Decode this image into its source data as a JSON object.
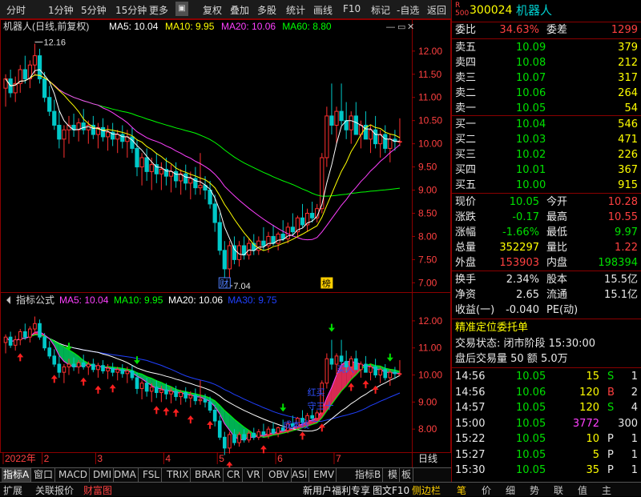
{
  "toolbar": {
    "items": [
      "分时",
      "1分钟",
      "5分钟",
      "15分钟",
      "更多",
      "复权",
      "叠加",
      "多股",
      "统计",
      "画线",
      "F10",
      "标记",
      "-自选",
      "返回"
    ]
  },
  "chart_data": [
    {
      "type": "candlestick",
      "title": "机器人(日线,前复权)",
      "legend": [
        {
          "name": "MA5",
          "value": "10.04",
          "color": "#ffffff"
        },
        {
          "name": "MA10",
          "value": "9.95",
          "color": "#ffff00"
        },
        {
          "name": "MA20",
          "value": "10.06",
          "color": "#ff40ff"
        },
        {
          "name": "MA60",
          "value": "8.80",
          "color": "#00ff00"
        }
      ],
      "y_ticks": [
        "12.00",
        "11.50",
        "11.00",
        "10.50",
        "10.00",
        "9.50",
        "9.00",
        "8.50",
        "8.00",
        "7.50",
        "7.00"
      ],
      "ylim": [
        6.85,
        12.55
      ],
      "annotations": [
        {
          "text": "12.16",
          "price": 12.16
        },
        {
          "text": "7.04",
          "price": 7.04
        }
      ],
      "markers": [
        "财",
        "榜"
      ],
      "ohlc": [
        [
          11.2,
          11.5,
          10.8,
          11.4
        ],
        [
          11.4,
          11.6,
          11.0,
          11.1
        ],
        [
          11.1,
          11.45,
          10.9,
          11.3
        ],
        [
          11.3,
          11.7,
          11.1,
          11.6
        ],
        [
          11.6,
          11.9,
          11.3,
          11.4
        ],
        [
          11.4,
          11.8,
          11.2,
          11.7
        ],
        [
          11.7,
          12.16,
          11.5,
          11.9
        ],
        [
          11.9,
          12.05,
          11.3,
          11.4
        ],
        [
          11.4,
          11.55,
          10.9,
          11.0
        ],
        [
          11.0,
          11.25,
          10.6,
          10.7
        ],
        [
          10.7,
          10.95,
          10.3,
          10.4
        ],
        [
          10.4,
          10.7,
          9.9,
          10.1
        ],
        [
          10.1,
          10.4,
          9.7,
          10.3
        ],
        [
          10.3,
          10.6,
          10.0,
          10.4
        ],
        [
          10.4,
          10.65,
          10.15,
          10.3
        ],
        [
          10.3,
          10.55,
          10.05,
          10.45
        ],
        [
          10.45,
          10.75,
          10.2,
          10.3
        ],
        [
          10.3,
          10.5,
          10.0,
          10.4
        ],
        [
          10.4,
          10.6,
          10.1,
          10.2
        ],
        [
          10.2,
          10.45,
          9.9,
          10.35
        ],
        [
          10.35,
          10.55,
          10.05,
          10.15
        ],
        [
          10.15,
          10.4,
          9.85,
          10.25
        ],
        [
          10.25,
          10.45,
          9.95,
          10.1
        ],
        [
          10.1,
          10.3,
          9.8,
          10.2
        ],
        [
          10.2,
          10.4,
          9.9,
          10.05
        ],
        [
          10.05,
          10.3,
          9.7,
          10.15
        ],
        [
          10.15,
          10.35,
          9.8,
          9.9
        ],
        [
          9.9,
          10.1,
          9.3,
          9.5
        ],
        [
          9.5,
          9.8,
          9.1,
          9.7
        ],
        [
          9.7,
          9.9,
          9.2,
          9.4
        ],
        [
          9.4,
          9.7,
          9.0,
          9.55
        ],
        [
          9.55,
          9.8,
          9.15,
          9.35
        ],
        [
          9.35,
          9.6,
          9.0,
          9.45
        ],
        [
          9.45,
          9.7,
          9.1,
          9.3
        ],
        [
          9.3,
          9.55,
          8.95,
          9.4
        ],
        [
          9.4,
          9.6,
          9.05,
          9.2
        ],
        [
          9.2,
          9.45,
          8.9,
          9.35
        ],
        [
          9.35,
          9.55,
          9.0,
          9.15
        ],
        [
          9.15,
          9.4,
          8.8,
          9.25
        ],
        [
          9.25,
          9.5,
          8.9,
          9.05
        ],
        [
          9.05,
          9.8,
          8.9,
          9.1
        ],
        [
          9.1,
          9.3,
          8.8,
          9.0
        ],
        [
          9.0,
          9.2,
          8.6,
          8.7
        ],
        [
          8.7,
          8.9,
          8.1,
          8.3
        ],
        [
          8.3,
          8.5,
          7.6,
          7.7
        ],
        [
          7.7,
          7.9,
          7.04,
          7.3
        ],
        [
          7.3,
          7.9,
          7.1,
          7.8
        ],
        [
          7.8,
          8.0,
          7.4,
          7.5
        ],
        [
          7.5,
          7.9,
          7.35,
          7.8
        ],
        [
          7.8,
          8.0,
          7.5,
          7.6
        ],
        [
          7.6,
          7.95,
          7.5,
          7.85
        ],
        [
          7.85,
          8.05,
          7.6,
          7.7
        ],
        [
          7.7,
          8.0,
          7.6,
          7.9
        ],
        [
          7.9,
          8.2,
          7.7,
          7.8
        ],
        [
          7.8,
          8.1,
          7.65,
          8.0
        ],
        [
          8.0,
          8.25,
          7.8,
          7.85
        ],
        [
          7.85,
          8.1,
          7.7,
          8.05
        ],
        [
          8.05,
          8.35,
          7.9,
          7.95
        ],
        [
          7.95,
          8.3,
          7.85,
          8.2
        ],
        [
          8.2,
          8.5,
          8.0,
          8.1
        ],
        [
          8.1,
          8.45,
          8.0,
          8.4
        ],
        [
          8.4,
          8.7,
          8.2,
          8.25
        ],
        [
          8.25,
          8.6,
          8.1,
          8.5
        ],
        [
          8.5,
          8.75,
          8.3,
          8.4
        ],
        [
          8.4,
          8.7,
          8.3,
          8.6
        ],
        [
          8.6,
          9.8,
          8.5,
          9.7
        ],
        [
          9.7,
          10.8,
          9.5,
          10.6
        ],
        [
          10.6,
          11.3,
          10.2,
          10.4
        ],
        [
          10.4,
          10.8,
          10.0,
          10.7
        ],
        [
          10.7,
          11.3,
          10.4,
          10.5
        ],
        [
          10.5,
          10.9,
          10.1,
          10.3
        ],
        [
          10.3,
          10.7,
          10.0,
          10.6
        ],
        [
          10.6,
          10.9,
          10.2,
          10.2
        ],
        [
          10.2,
          10.5,
          9.9,
          10.4
        ],
        [
          10.4,
          10.7,
          10.1,
          10.1
        ],
        [
          10.1,
          10.4,
          9.8,
          10.3
        ],
        [
          10.3,
          10.6,
          9.9,
          10.0
        ],
        [
          10.0,
          10.3,
          9.7,
          10.2
        ],
        [
          10.2,
          10.4,
          9.8,
          9.9
        ],
        [
          9.9,
          10.2,
          9.6,
          10.1
        ],
        [
          10.1,
          10.3,
          9.85,
          10.05
        ],
        [
          10.05,
          10.55,
          9.95,
          10.05
        ]
      ]
    },
    {
      "type": "line",
      "title": "指标公式",
      "legend": [
        {
          "name": "MA5",
          "value": "10.04",
          "color": "#ff40ff"
        },
        {
          "name": "MA10",
          "value": "9.95",
          "color": "#00ff00"
        },
        {
          "name": "MA20",
          "value": "10.06",
          "color": "#ffffff"
        },
        {
          "name": "MA30",
          "value": "9.75",
          "color": "#2040ff"
        }
      ],
      "y_ticks": [
        "12.00",
        "11.00",
        "10.00",
        "9.00",
        "8.00"
      ],
      "ylim": [
        7.0,
        12.5
      ],
      "x_ticks": [
        {
          "label": "2022年",
          "index": 0
        },
        {
          "label": "2",
          "index": 8
        },
        {
          "label": "3",
          "index": 19
        },
        {
          "label": "4",
          "index": 33
        },
        {
          "label": "5",
          "index": 44
        },
        {
          "label": "6",
          "index": 56
        },
        {
          "label": "7",
          "index": 68
        }
      ],
      "annotations": [
        {
          "text": "成本线"
        },
        {
          "text": "守三十"
        },
        {
          "text": "红买"
        },
        {
          "text": "买入"
        }
      ],
      "period_label": "日线"
    }
  ],
  "tabs": [
    "指标A",
    "窗口",
    "MACD",
    "DMI",
    "DMA",
    "FSL",
    "TRIX",
    "BRAR",
    "CR",
    "VR",
    "OBV",
    "ASI",
    "EMV",
    "指标B",
    "模",
    "板"
  ],
  "status": {
    "left": [
      "扩展",
      "关联报价",
      "财富图"
    ],
    "mid": "新用户福利专享",
    "mid2": "图文F10",
    "mid3": "侧边栏",
    "right": [
      "笔",
      "价",
      "细",
      "势",
      "联",
      "值",
      "主"
    ]
  },
  "quote": {
    "code": "300024",
    "name": "机器人",
    "badge_r": "R",
    "badge_n": "500",
    "weibi_label": "委比",
    "weibi": "34.63%",
    "weicha_label": "委差",
    "weicha": "1299",
    "asks": [
      {
        "label": "卖五",
        "price": "10.09",
        "vol": "379"
      },
      {
        "label": "卖四",
        "price": "10.08",
        "vol": "212"
      },
      {
        "label": "卖三",
        "price": "10.07",
        "vol": "317"
      },
      {
        "label": "卖二",
        "price": "10.06",
        "vol": "264"
      },
      {
        "label": "卖一",
        "price": "10.05",
        "vol": "54"
      }
    ],
    "bids": [
      {
        "label": "买一",
        "price": "10.04",
        "vol": "546"
      },
      {
        "label": "买二",
        "price": "10.03",
        "vol": "471"
      },
      {
        "label": "买三",
        "price": "10.02",
        "vol": "226"
      },
      {
        "label": "买四",
        "price": "10.01",
        "vol": "367"
      },
      {
        "label": "买五",
        "price": "10.00",
        "vol": "915"
      }
    ],
    "stats": [
      {
        "l1": "现价",
        "v1": "10.05",
        "l2": "今开",
        "v2": "10.28",
        "c1": "grn",
        "c2": "red"
      },
      {
        "l1": "涨跌",
        "v1": "-0.17",
        "l2": "最高",
        "v2": "10.55",
        "c1": "grn",
        "c2": "red"
      },
      {
        "l1": "涨幅",
        "v1": "-1.66%",
        "l2": "最低",
        "v2": "9.97",
        "c1": "grn",
        "c2": "grn"
      },
      {
        "l1": "总量",
        "v1": "352297",
        "l2": "量比",
        "v2": "1.22",
        "c1": "yel",
        "c2": "red"
      },
      {
        "l1": "外盘",
        "v1": "153903",
        "l2": "内盘",
        "v2": "198394",
        "c1": "red",
        "c2": "grn"
      }
    ],
    "stats2": [
      {
        "l1": "换手",
        "v1": "2.34%",
        "l2": "股本",
        "v2": "15.5亿"
      },
      {
        "l1": "净资",
        "v1": "2.65",
        "l2": "流通",
        "v2": "15.1亿"
      },
      {
        "l1": "收益(一)",
        "v1": "-0.040",
        "l2": "PE(动)",
        "v2": ""
      }
    ],
    "precise": "精准定位委托单",
    "trade_status": "交易状态: 闭市阶段 15:30:00",
    "after_hours": "盘后交易量 50 额 5.0万",
    "ticks": [
      {
        "t": "14:56",
        "p": "10.05",
        "v": "15",
        "s": "S",
        "n": "1",
        "vc": "yel",
        "sc": "grn"
      },
      {
        "t": "14:56",
        "p": "10.06",
        "v": "120",
        "s": "B",
        "n": "2",
        "vc": "yel",
        "sc": "red"
      },
      {
        "t": "14:57",
        "p": "10.05",
        "v": "120",
        "s": "S",
        "n": "4",
        "vc": "yel",
        "sc": "grn"
      },
      {
        "t": "15:00",
        "p": "10.05",
        "v": "3772",
        "s": "",
        "n": "300",
        "vc": "mag",
        "sc": "wht"
      },
      {
        "t": "15:22",
        "p": "10.05",
        "v": "10",
        "s": "P",
        "n": "1",
        "vc": "yel",
        "sc": "wht"
      },
      {
        "t": "15:27",
        "p": "10.05",
        "v": "5",
        "s": "P",
        "n": "1",
        "vc": "yel",
        "sc": "wht"
      },
      {
        "t": "15:30",
        "p": "10.05",
        "v": "35",
        "s": "P",
        "n": "1",
        "vc": "yel",
        "sc": "wht"
      }
    ]
  }
}
